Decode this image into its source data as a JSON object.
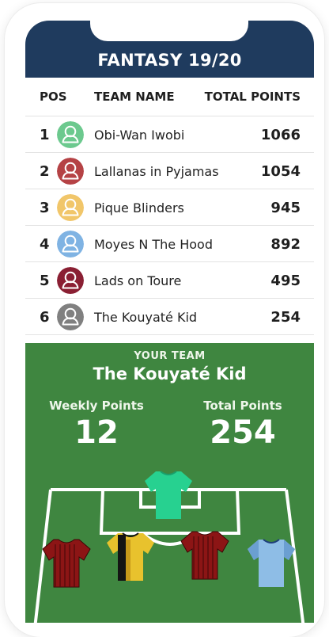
{
  "app": {
    "title": "FANTASY 19/20"
  },
  "table": {
    "headers": {
      "pos": "POS",
      "name": "TEAM NAME",
      "points": "TOTAL POINTS"
    },
    "rows": [
      {
        "pos": "1",
        "name": "Obi-Wan Iwobi",
        "points": "1066",
        "avatar_icon": "user-avatar-icon",
        "avatar_color": "#6cc98e"
      },
      {
        "pos": "2",
        "name": "Lallanas in Pyjamas",
        "points": "1054",
        "avatar_icon": "user-avatar-icon",
        "avatar_color": "#b54245"
      },
      {
        "pos": "3",
        "name": "Pique Blinders",
        "points": "945",
        "avatar_icon": "user-avatar-icon",
        "avatar_color": "#f1c66a"
      },
      {
        "pos": "4",
        "name": "Moyes N The Hood",
        "points": "892",
        "avatar_icon": "user-avatar-icon",
        "avatar_color": "#7fb3e3"
      },
      {
        "pos": "5",
        "name": "Lads on Toure",
        "points": "495",
        "avatar_icon": "user-avatar-icon",
        "avatar_color": "#8a1f33"
      },
      {
        "pos": "6",
        "name": "The Kouyaté Kid",
        "points": "254",
        "avatar_icon": "user-avatar-icon",
        "avatar_color": "#808080"
      }
    ]
  },
  "your_team": {
    "label": "YOUR TEAM",
    "name": "The Kouyaté Kid",
    "weekly_label": "Weekly Points",
    "weekly_value": "12",
    "total_label": "Total Points",
    "total_value": "254"
  },
  "players": [
    {
      "role": "goalkeeper",
      "icon": "green-shirt-icon",
      "color": "#27d190"
    },
    {
      "role": "defender",
      "icon": "claret-striped-shirt-icon",
      "color": "#8c1515"
    },
    {
      "role": "defender",
      "icon": "black-yellow-shirt-icon",
      "color": "#e8c22d"
    },
    {
      "role": "defender",
      "icon": "claret-striped-shirt-icon",
      "color": "#8c1515"
    },
    {
      "role": "defender",
      "icon": "sky-blue-shirt-icon",
      "color": "#8ebde6"
    }
  ],
  "colors": {
    "header_bg": "#1f3b5e",
    "pitch_bg": "#3f8640"
  }
}
